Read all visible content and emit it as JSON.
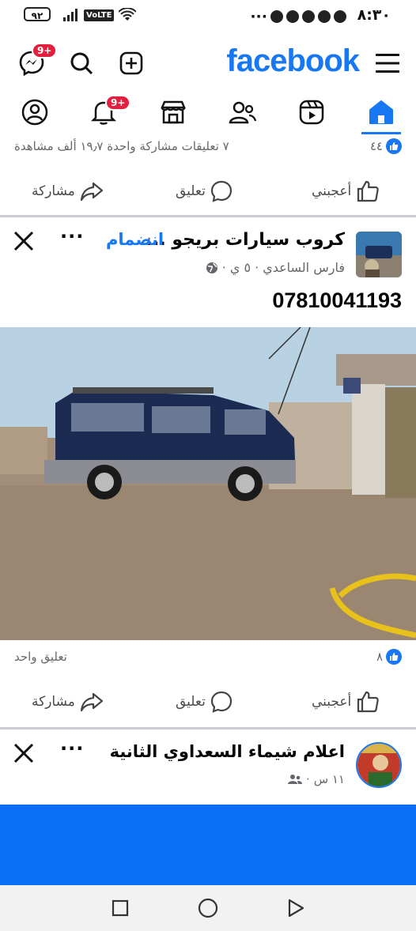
{
  "status_bar": {
    "time": "٨:٣٠",
    "battery": "٩٢",
    "volte": "VoLTE"
  },
  "header": {
    "logo": "facebook",
    "messenger_badge": "9+"
  },
  "tabs": {
    "notifications_badge": "9+",
    "items": [
      "home",
      "video",
      "friends",
      "marketplace",
      "notifications",
      "profile"
    ]
  },
  "post_prev": {
    "reaction_count": "٤٤",
    "stats": "٧ تعليقات  مشاركة واحدة  ١٩٫٧ ألف مشاهدة",
    "like": "أعجبني",
    "comment": "تعليق",
    "share": "مشاركة"
  },
  "post_main": {
    "group_name": "كروب سيارات بريجو ...",
    "join": "انضمام",
    "author": "فارس الساعدي",
    "time": "٥ ي",
    "body": "07810041193",
    "reaction_count": "٨",
    "comments": "تعليق واحد",
    "like": "أعجبني",
    "comment": "تعليق",
    "share": "مشاركة"
  },
  "post_next": {
    "name": "اعلام شيماء السعداوي الثانية",
    "time": "١١ س"
  },
  "colors": {
    "brand": "#1877f2",
    "badge": "#e41e3f",
    "banner": "#0a6ef6"
  }
}
